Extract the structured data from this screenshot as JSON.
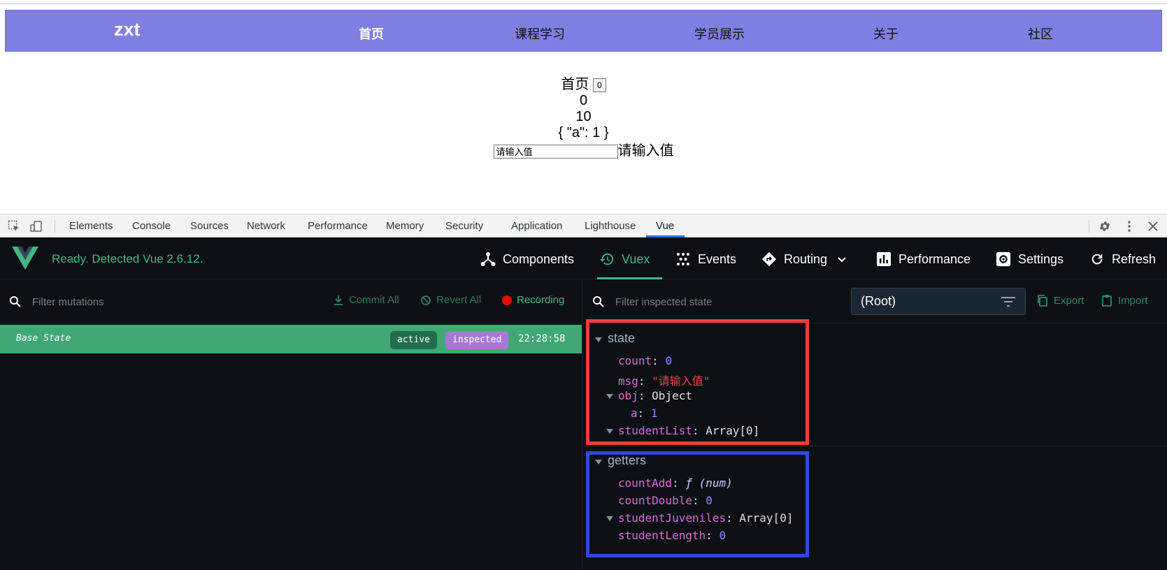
{
  "nav": {
    "brand": "zxt",
    "links": [
      "首页",
      "课程学习",
      "学员展示",
      "关于",
      "社区"
    ]
  },
  "content": {
    "title": "首页",
    "counter_button": "0",
    "line1": "0",
    "line2": "10",
    "line3": "{ \"a\": 1 }",
    "input_value": "请输入值",
    "input_echo": "请输入值"
  },
  "devtools": {
    "tabs": [
      "Elements",
      "Console",
      "Sources",
      "Network",
      "Performance",
      "Memory",
      "Security",
      "Application",
      "Lighthouse",
      "Vue"
    ],
    "active_tab": "Vue"
  },
  "vue": {
    "status": "Ready. Detected Vue 2.6.12.",
    "header_buttons": {
      "components": "Components",
      "vuex": "Vuex",
      "events": "Events",
      "routing": "Routing",
      "performance": "Performance",
      "settings": "Settings",
      "refresh": "Refresh"
    },
    "left": {
      "filter_placeholder": "Filter mutations",
      "commit_all": "Commit All",
      "revert_all": "Revert All",
      "recording": "Recording",
      "base_state": {
        "label": "Base State",
        "badge_active": "active",
        "badge_inspected": "inspected",
        "time": "22:28:58"
      }
    },
    "right": {
      "filter_placeholder": "Filter inspected state",
      "root_select": "(Root)",
      "export": "Export",
      "import": "Import",
      "state": {
        "title": "state",
        "count_key": "count",
        "count_val": "0",
        "msg_key": "msg",
        "msg_val": "\"请输入值\"",
        "obj_key": "obj",
        "obj_type": "Object",
        "a_key": "a",
        "a_val": "1",
        "studentList_key": "studentList",
        "studentList_type": "Array[0]"
      },
      "getters": {
        "title": "getters",
        "countAdd_key": "countAdd",
        "countAdd_val": "ƒ (num)",
        "countDouble_key": "countDouble",
        "countDouble_val": "0",
        "studentJuveniles_key": "studentJuveniles",
        "studentJuveniles_type": "Array[0]",
        "studentLength_key": "studentLength",
        "studentLength_val": "0"
      }
    }
  },
  "colors": {
    "nav_bg": "#7f7fe3",
    "vue_green": "#41b883",
    "base_row": "#41a875",
    "highlight_red": "#f03c3c",
    "highlight_blue": "#2e4bd6"
  }
}
